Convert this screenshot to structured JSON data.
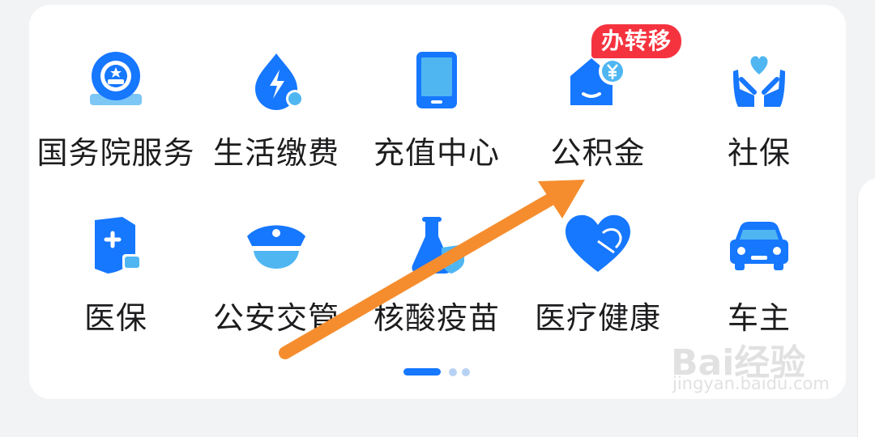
{
  "colors": {
    "accent": "#1677ff",
    "badge": "#f5333f",
    "arrow": "#f58d2e",
    "text": "#1d1d1f"
  },
  "services": [
    {
      "label": "国务院服务",
      "icon": "state-council-emblem-icon"
    },
    {
      "label": "生活缴费",
      "icon": "water-drop-bolt-icon"
    },
    {
      "label": "充值中心",
      "icon": "tablet-icon"
    },
    {
      "label": "公积金",
      "icon": "house-fund-yen-icon",
      "badge": "办转移"
    },
    {
      "label": "社保",
      "icon": "hands-heart-icon"
    },
    {
      "label": "医保",
      "icon": "medical-shield-icon"
    },
    {
      "label": "公安交管",
      "icon": "police-cap-icon"
    },
    {
      "label": "核酸疫苗",
      "icon": "flask-shield-icon"
    },
    {
      "label": "医疗健康",
      "icon": "heart-icon"
    },
    {
      "label": "车主",
      "icon": "car-icon"
    }
  ],
  "pager": {
    "pages": 3,
    "current": 1
  },
  "watermark": {
    "brand": "Bai经验",
    "url": "jingyan.baidu.com"
  }
}
